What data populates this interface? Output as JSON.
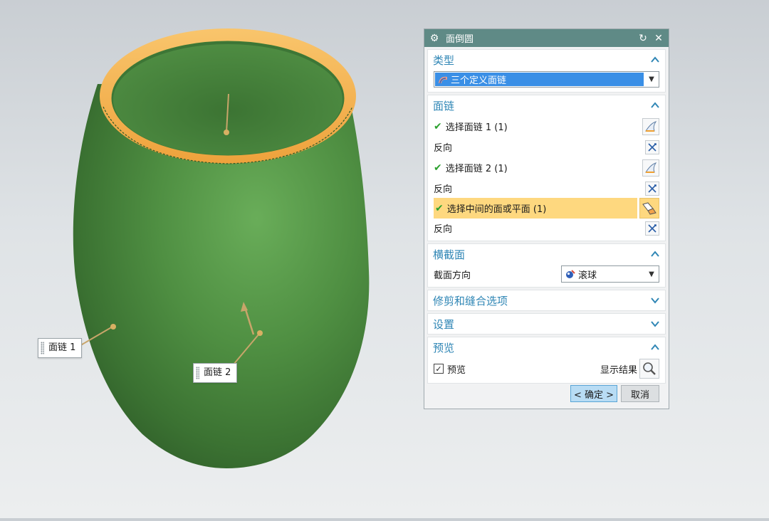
{
  "viewport": {
    "callout_1": "面链 1",
    "callout_2": "面链 2"
  },
  "dialog": {
    "title": "面倒圆",
    "sections": {
      "type": {
        "header": "类型",
        "selected": "三个定义面链"
      },
      "face_chain": {
        "header": "面链",
        "select_chain_1": "选择面链 1 (1)",
        "reverse_1": "反向",
        "select_chain_2": "选择面链 2 (1)",
        "reverse_2": "反向",
        "select_middle": "选择中间的面或平面 (1)",
        "reverse_3": "反向"
      },
      "cross_section": {
        "header": "横截面",
        "direction_label": "截面方向",
        "direction_value": "滚球"
      },
      "trim": {
        "header": "修剪和缝合选项"
      },
      "settings": {
        "header": "设置"
      },
      "preview": {
        "header": "预览",
        "preview_label": "预览",
        "preview_checked": true,
        "show_result": "显示结果"
      }
    },
    "ok_button": "< 确定 >",
    "cancel_button": "取消"
  },
  "colors": {
    "vase": "#4e8c3f",
    "rim": "#f5b451",
    "title_bar": "#5f8a86",
    "section_header_text": "#2f86b5",
    "highlight_row": "#fed87f"
  }
}
